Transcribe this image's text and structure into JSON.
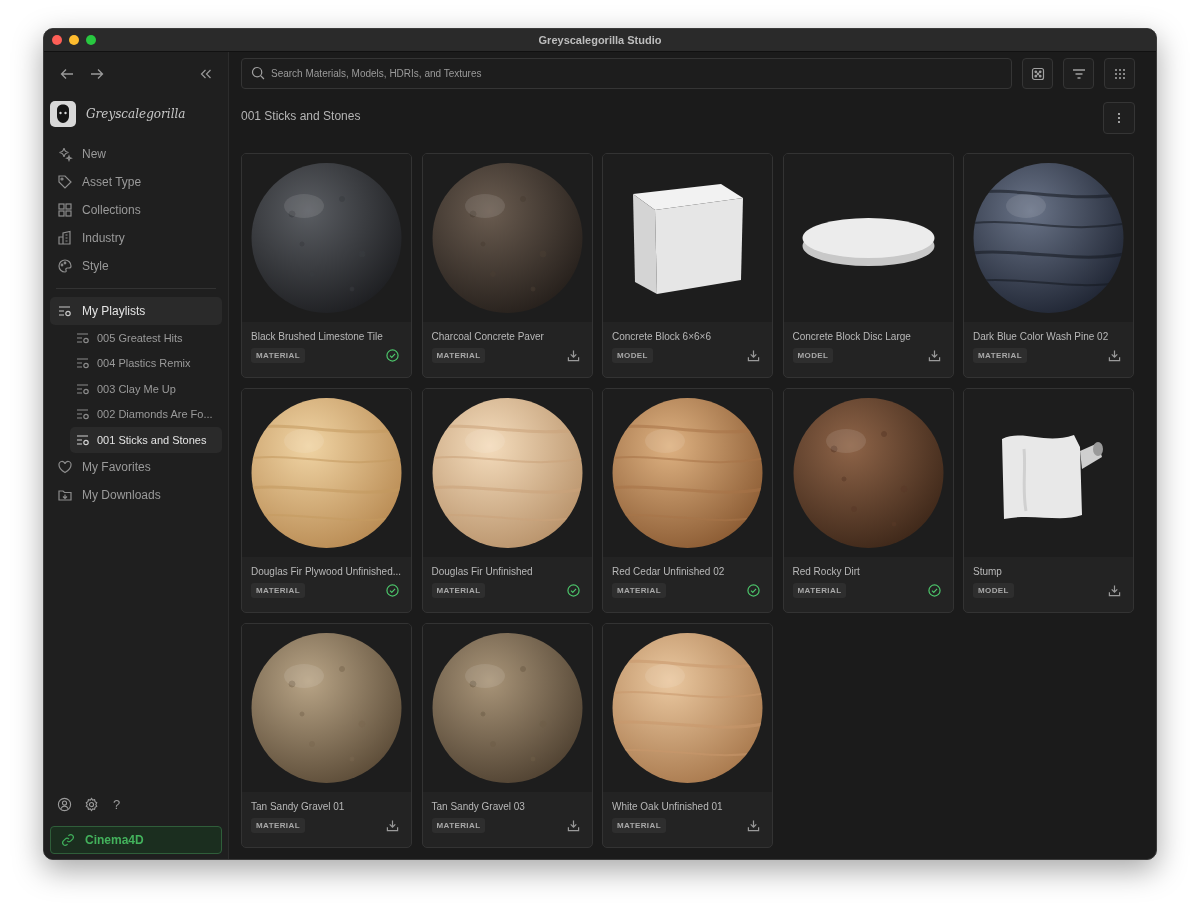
{
  "window": {
    "title": "Greyscalegorilla Studio"
  },
  "sidebar": {
    "logo_text": "Greyscalegorilla",
    "nav": [
      {
        "label": "New"
      },
      {
        "label": "Asset Type"
      },
      {
        "label": "Collections"
      },
      {
        "label": "Industry"
      },
      {
        "label": "Style"
      }
    ],
    "playlists": {
      "label": "My Playlists",
      "selected": true,
      "children": [
        {
          "label": "005 Greatest Hits",
          "selected": false
        },
        {
          "label": "004 Plastics Remix",
          "selected": false
        },
        {
          "label": "003 Clay Me Up",
          "selected": false
        },
        {
          "label": "002 Diamonds Are Fo...",
          "selected": false
        },
        {
          "label": "001 Sticks and Stones",
          "selected": true
        }
      ]
    },
    "more": [
      {
        "label": "My Favorites"
      },
      {
        "label": "My Downloads"
      }
    ],
    "help": "?",
    "connect_button": "Cinema4D"
  },
  "search": {
    "placeholder": "Search Materials, Models, HDRIs, and Textures"
  },
  "page_title": "001 Sticks and Stones",
  "cards": [
    {
      "name": "Black Brushed Limestone Tile",
      "tag": "MATERIAL",
      "downloaded": true
    },
    {
      "name": "Charcoal Concrete Paver",
      "tag": "MATERIAL",
      "downloaded": false
    },
    {
      "name": "Concrete Block 6×6×6",
      "tag": "MODEL",
      "downloaded": false
    },
    {
      "name": "Concrete Block Disc Large",
      "tag": "MODEL",
      "downloaded": false
    },
    {
      "name": "Dark Blue Color Wash Pine 02",
      "tag": "MATERIAL",
      "downloaded": false
    },
    {
      "name": "Douglas Fir Plywood Unfinished...",
      "tag": "MATERIAL",
      "downloaded": true
    },
    {
      "name": "Douglas Fir Unfinished",
      "tag": "MATERIAL",
      "downloaded": true
    },
    {
      "name": "Red Cedar Unfinished 02",
      "tag": "MATERIAL",
      "downloaded": true
    },
    {
      "name": "Red Rocky Dirt",
      "tag": "MATERIAL",
      "downloaded": true
    },
    {
      "name": "Stump",
      "tag": "MODEL",
      "downloaded": false
    },
    {
      "name": "Tan Sandy Gravel 01",
      "tag": "MATERIAL",
      "downloaded": false
    },
    {
      "name": "Tan Sandy Gravel 03",
      "tag": "MATERIAL",
      "downloaded": false
    },
    {
      "name": "White Oak Unfinished 01",
      "tag": "MATERIAL",
      "downloaded": false
    }
  ]
}
